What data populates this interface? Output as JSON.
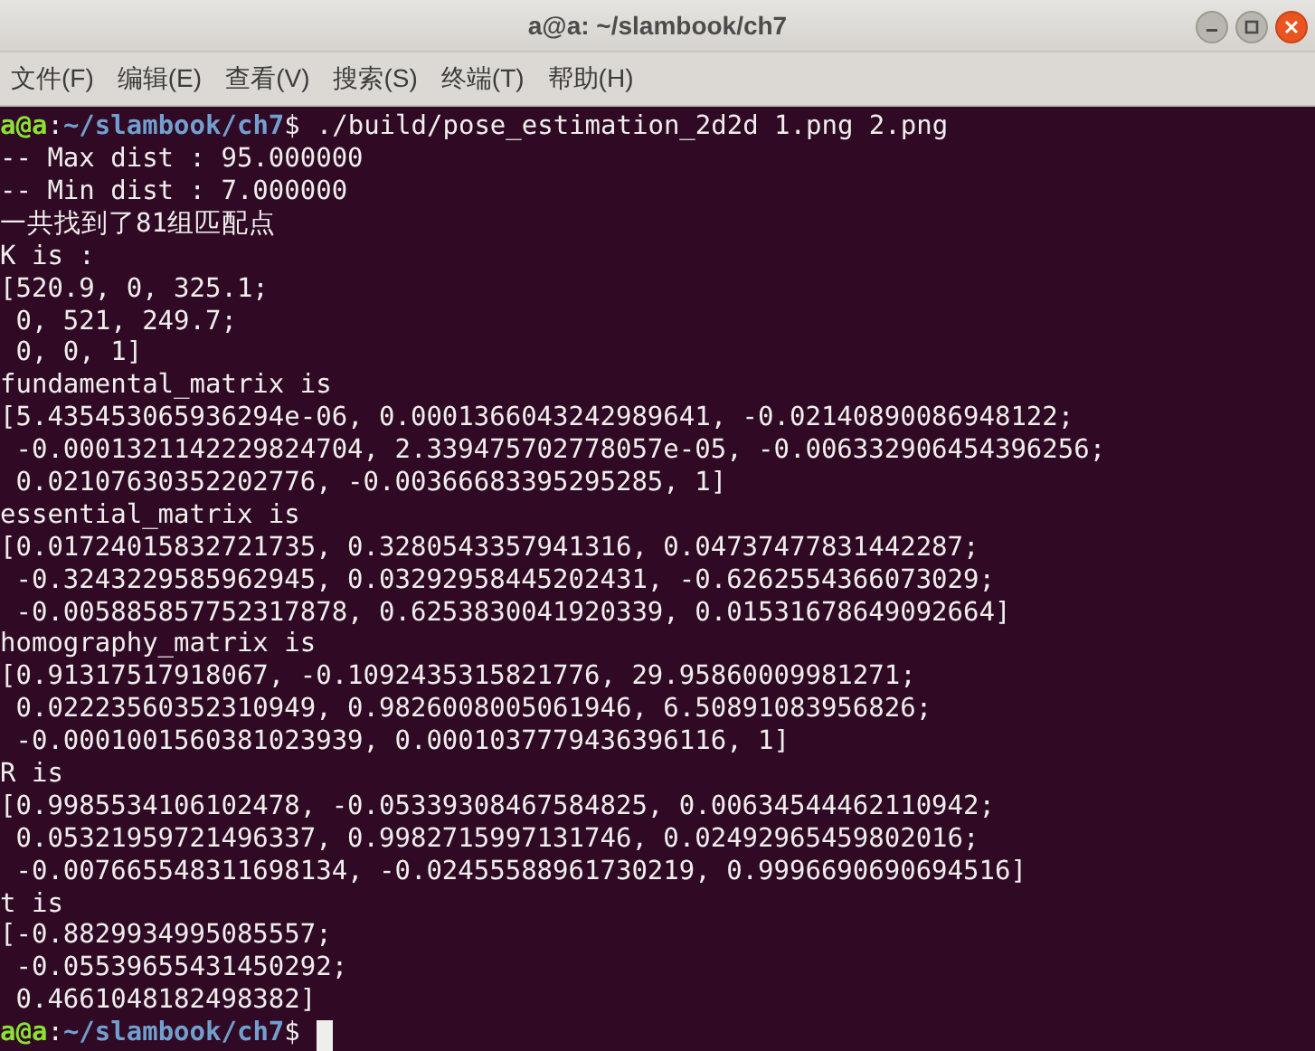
{
  "window": {
    "title": "a@a: ~/slambook/ch7"
  },
  "menu": [
    "文件(F)",
    "编辑(E)",
    "查看(V)",
    "搜索(S)",
    "终端(T)",
    "帮助(H)"
  ],
  "terminal": {
    "lines": [
      {
        "kind": "prompt",
        "user": "a@a",
        "separator": ":",
        "path": "~/slambook/ch7",
        "symbol": "$",
        "command": "./build/pose_estimation_2d2d 1.png 2.png"
      },
      {
        "kind": "output",
        "text": "-- Max dist : 95.000000"
      },
      {
        "kind": "output",
        "text": "-- Min dist : 7.000000"
      },
      {
        "kind": "output",
        "text": "一共找到了81组匹配点"
      },
      {
        "kind": "output",
        "text": "K is :"
      },
      {
        "kind": "output",
        "text": "[520.9, 0, 325.1;"
      },
      {
        "kind": "output",
        "text": " 0, 521, 249.7;"
      },
      {
        "kind": "output",
        "text": " 0, 0, 1]"
      },
      {
        "kind": "output",
        "text": "fundamental_matrix is"
      },
      {
        "kind": "output",
        "text": "[5.435453065936294e-06, 0.0001366043242989641, -0.02140890086948122;"
      },
      {
        "kind": "output",
        "text": " -0.0001321142229824704, 2.339475702778057e-05, -0.006332906454396256;"
      },
      {
        "kind": "output",
        "text": " 0.02107630352202776, -0.00366683395295285, 1]"
      },
      {
        "kind": "output",
        "text": "essential_matrix is"
      },
      {
        "kind": "output",
        "text": "[0.01724015832721735, 0.3280543357941316, 0.04737477831442287;"
      },
      {
        "kind": "output",
        "text": " -0.3243229585962945, 0.03292958445202431, -0.6262554366073029;"
      },
      {
        "kind": "output",
        "text": " -0.005885857752317878, 0.6253830041920339, 0.01531678649092664]"
      },
      {
        "kind": "output",
        "text": "homography_matrix is"
      },
      {
        "kind": "output",
        "text": "[0.91317517918067, -0.1092435315821776, 29.95860009981271;"
      },
      {
        "kind": "output",
        "text": " 0.02223560352310949, 0.9826008005061946, 6.50891083956826;"
      },
      {
        "kind": "output",
        "text": " -0.0001001560381023939, 0.0001037779436396116, 1]"
      },
      {
        "kind": "output",
        "text": "R is"
      },
      {
        "kind": "output",
        "text": "[0.9985534106102478, -0.05339308467584825, 0.00634544462110942;"
      },
      {
        "kind": "output",
        "text": " 0.05321959721496337, 0.9982715997131746, 0.02492965459802016;"
      },
      {
        "kind": "output",
        "text": " -0.007665548311698134, -0.02455588961730219, 0.9996690690694516]"
      },
      {
        "kind": "output",
        "text": "t is"
      },
      {
        "kind": "output",
        "text": "[-0.8829934995085557;"
      },
      {
        "kind": "output",
        "text": " -0.05539655431450292;"
      },
      {
        "kind": "output",
        "text": " 0.4661048182498382]"
      },
      {
        "kind": "prompt",
        "user": "a@a",
        "separator": ":",
        "path": "~/slambook/ch7",
        "symbol": "$",
        "cursor": true
      }
    ]
  }
}
